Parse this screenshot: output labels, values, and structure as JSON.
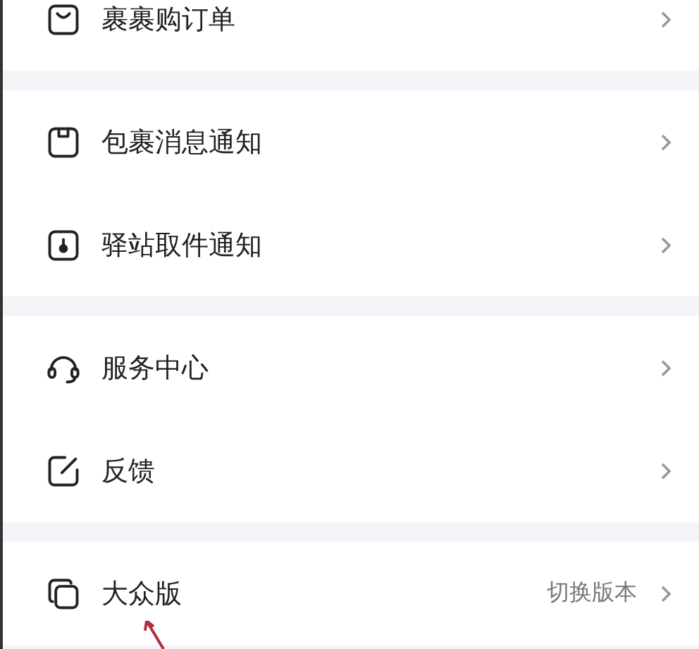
{
  "sections": [
    {
      "items": [
        {
          "label": "裹裹购订单"
        }
      ]
    },
    {
      "items": [
        {
          "label": "包裹消息通知"
        },
        {
          "label": "驿站取件通知"
        }
      ]
    },
    {
      "items": [
        {
          "label": "服务中心"
        },
        {
          "label": "反馈"
        }
      ]
    },
    {
      "items": [
        {
          "label": "大众版",
          "value": "切换版本"
        }
      ]
    }
  ]
}
